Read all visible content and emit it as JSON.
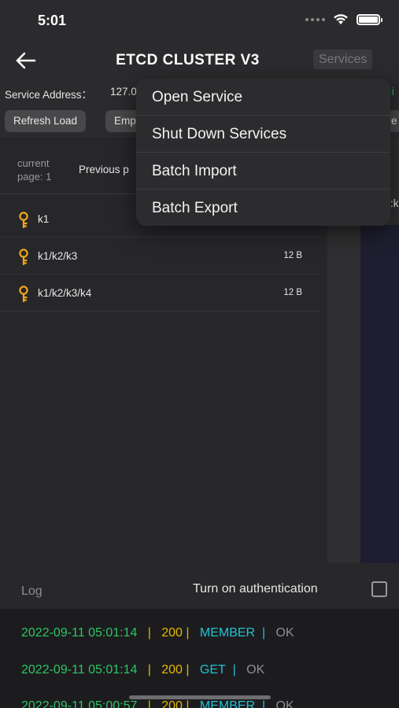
{
  "status_bar": {
    "time": "5:01"
  },
  "nav": {
    "title": "ETCD CLUSTER V3",
    "services_label": "Services"
  },
  "service": {
    "label": "Service Address：",
    "value": "127.0",
    "suffix": ".i"
  },
  "buttons": {
    "refresh": "Refresh Load",
    "empty": "Emp",
    "right_fragment": "le"
  },
  "pagination": {
    "current_line1": "current",
    "current_line2": "page:  1",
    "previous": "Previous p"
  },
  "keys": [
    {
      "name": "k1",
      "size": ""
    },
    {
      "name": "k1/k2/k3",
      "size": "12 B"
    },
    {
      "name": "k1/k2/k3/k4",
      "size": "12 B"
    }
  ],
  "right_panel": {
    "fragment": ":k"
  },
  "log": {
    "title": "Log",
    "auth_label": "Turn on authentication",
    "auth_checked": false,
    "entries": [
      {
        "date": "2022-09-11 05:01:14",
        "code": "200",
        "method": "MEMBER",
        "status": "OK"
      },
      {
        "date": "2022-09-11 05:01:14",
        "code": "200",
        "method": "GET",
        "status": "OK"
      },
      {
        "date": "2022-09-11 05:00:57",
        "code": "200",
        "method": "MEMBER",
        "status": "OK"
      }
    ]
  },
  "dropdown": {
    "items": [
      "Open Service",
      "Shut Down Services",
      "Batch Import",
      "Batch Export"
    ]
  },
  "colors": {
    "date": "#2ec466",
    "code": "#e6b800",
    "method": "#22c1d6",
    "ok": "#8e8e93",
    "key_icon": "#f0a61e",
    "services_text": "#77777a"
  },
  "icons": {
    "back": "back-arrow-icon",
    "key": "key-icon",
    "wifi": "wifi-icon",
    "battery": "battery-icon",
    "signal": "signal-icon",
    "checkbox": "checkbox-icon"
  }
}
